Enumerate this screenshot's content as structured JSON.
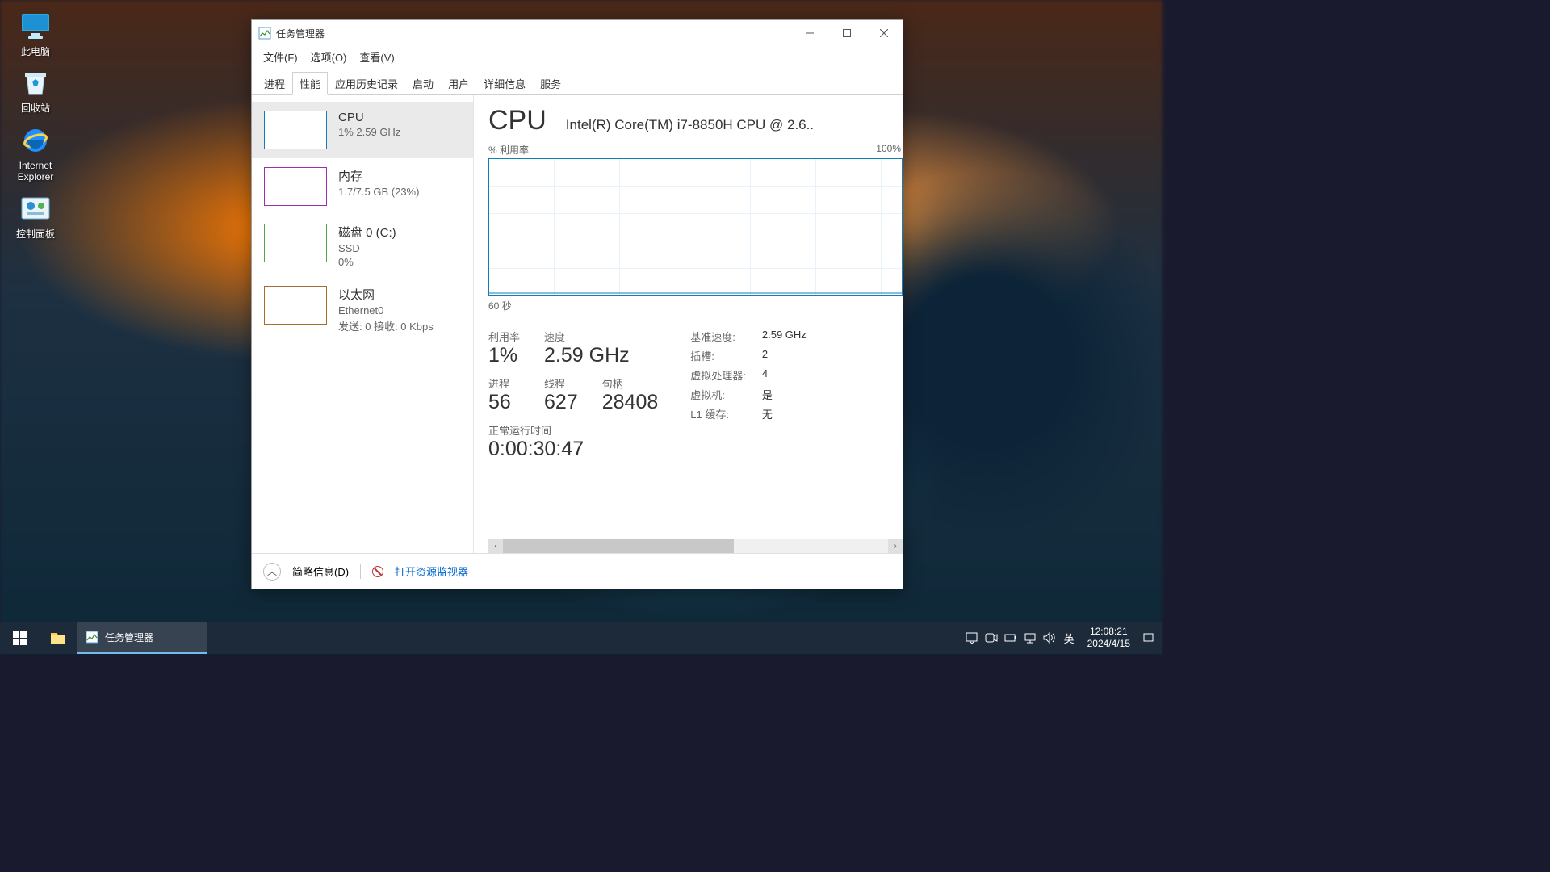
{
  "desktop_icons": {
    "this_pc": "此电脑",
    "recycle_bin": "回收站",
    "ie": "Internet Explorer",
    "control_panel": "控制面板"
  },
  "window": {
    "title": "任务管理器",
    "menu": {
      "file": "文件(F)",
      "options": "选项(O)",
      "view": "查看(V)"
    },
    "tabs": {
      "processes": "进程",
      "performance": "性能",
      "app_history": "应用历史记录",
      "startup": "启动",
      "users": "用户",
      "details": "详细信息",
      "services": "服务"
    },
    "active_tab": "performance"
  },
  "sidebar": {
    "cpu": {
      "title": "CPU",
      "sub": "1%  2.59 GHz"
    },
    "mem": {
      "title": "内存",
      "sub": "1.7/7.5 GB (23%)"
    },
    "disk": {
      "title": "磁盘 0 (C:)",
      "sub1": "SSD",
      "sub2": "0%"
    },
    "net": {
      "title": "以太网",
      "sub1": "Ethernet0",
      "sub2": "发送: 0  接收: 0 Kbps"
    }
  },
  "detail": {
    "heading": "CPU",
    "model": "Intel(R) Core(TM) i7-8850H CPU @ 2.6..",
    "chart": {
      "ylabel": "% 利用率",
      "ymax": "100%",
      "xmax": "60 秒"
    },
    "primary": {
      "util_label": "利用率",
      "util_value": "1%",
      "speed_label": "速度",
      "speed_value": "2.59 GHz",
      "proc_label": "进程",
      "proc_value": "56",
      "threads_label": "线程",
      "threads_value": "627",
      "handles_label": "句柄",
      "handles_value": "28408",
      "uptime_label": "正常运行时间",
      "uptime_value": "0:00:30:47"
    },
    "secondary": {
      "base_speed_k": "基准速度:",
      "base_speed_v": "2.59 GHz",
      "sockets_k": "插槽:",
      "sockets_v": "2",
      "vprocs_k": "虚拟处理器:",
      "vprocs_v": "4",
      "vm_k": "虚拟机:",
      "vm_v": "是",
      "l1_k": "L1 缓存:",
      "l1_v": "无"
    }
  },
  "footer": {
    "fewer_details": "简略信息(D)",
    "open_resmon": "打开资源监视器"
  },
  "taskbar": {
    "app_label": "任务管理器",
    "ime": "英",
    "time": "12:08:21",
    "date": "2024/4/15"
  },
  "chart_data": {
    "type": "line",
    "title": "% 利用率",
    "xlabel": "60 秒",
    "ylabel": "% 利用率",
    "ylim": [
      0,
      100
    ],
    "x_seconds": [
      60,
      55,
      50,
      45,
      40,
      35,
      30,
      25,
      20,
      15,
      10,
      5,
      0
    ],
    "series": [
      {
        "name": "CPU 利用率 %",
        "values": [
          1,
          1,
          1,
          1,
          1,
          1,
          1,
          1,
          1,
          1,
          1,
          1,
          1
        ]
      }
    ]
  }
}
